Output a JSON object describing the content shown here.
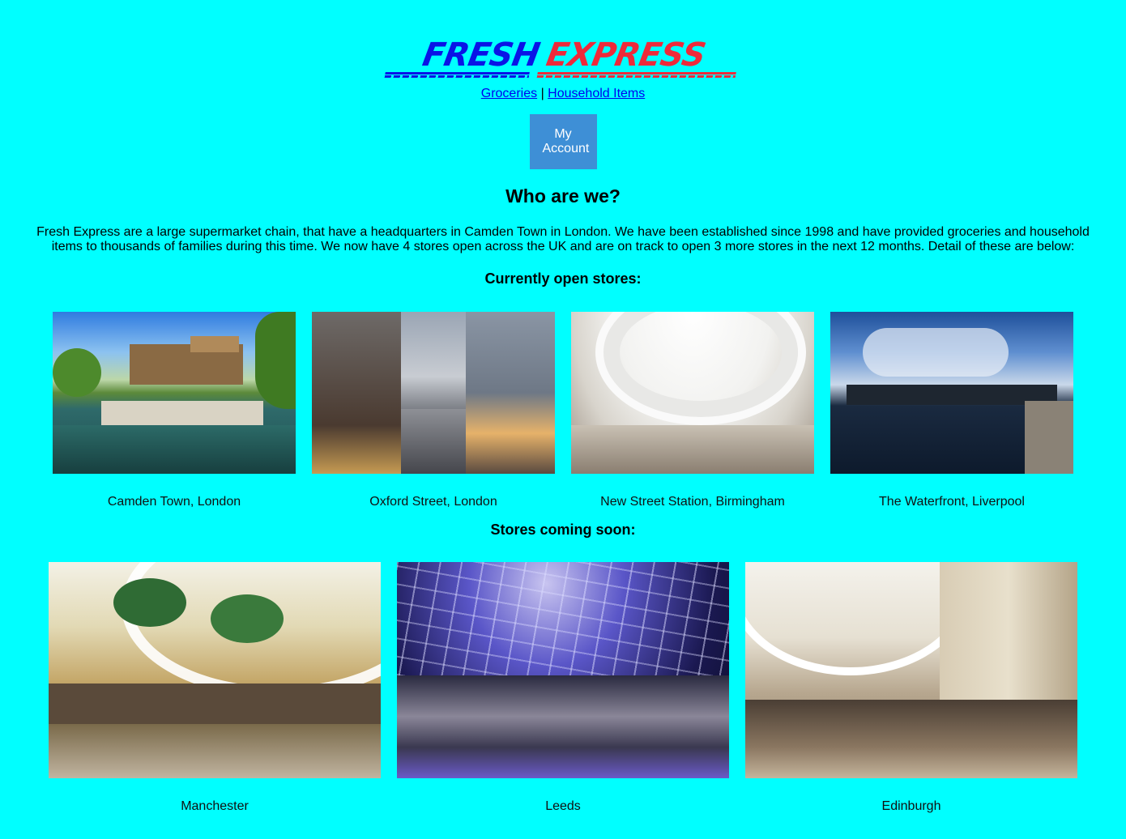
{
  "brand": {
    "word1": "FRESH",
    "word2": "EXPRESS"
  },
  "nav": {
    "groceries": "Groceries",
    "separator": "|",
    "household": "Household Items"
  },
  "account_button": "My Account",
  "about": {
    "heading": "Who are we?",
    "body": "Fresh Express are a large supermarket chain, that have a headquarters in Camden Town in London. We have been established since 1998 and have provided groceries and household items to thousands of families during this time. We now have 4 stores open across the UK and are on track to open 3 more stores in the next 12 months. Detail of these are below:"
  },
  "open_stores": {
    "heading": "Currently open stores:",
    "items": [
      {
        "caption": "Camden Town, London"
      },
      {
        "caption": "Oxford Street, London"
      },
      {
        "caption": "New Street Station, Birmingham"
      },
      {
        "caption": "The Waterfront, Liverpool"
      }
    ]
  },
  "soon_stores": {
    "heading": "Stores coming soon:",
    "items": [
      {
        "caption": "Manchester"
      },
      {
        "caption": "Leeds"
      },
      {
        "caption": "Edinburgh"
      }
    ]
  },
  "colors": {
    "background": "#00ffff",
    "brand_blue": "#0a14e6",
    "brand_red": "#ee2a3a",
    "button": "#3e8fd6"
  }
}
